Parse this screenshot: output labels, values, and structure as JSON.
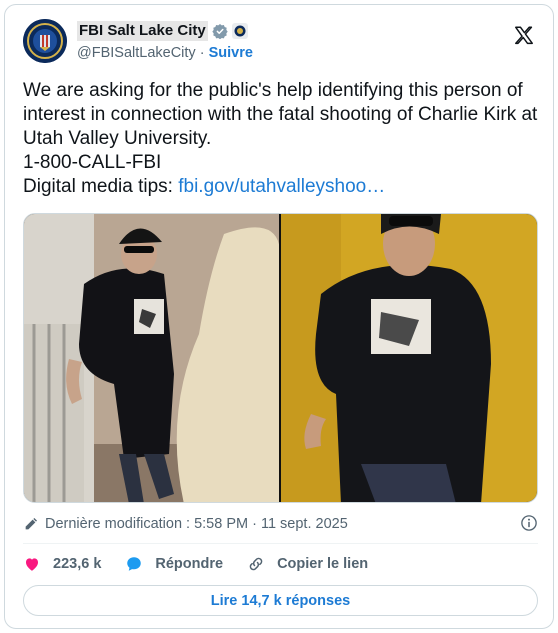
{
  "post": {
    "display_name": "FBI Salt Lake City",
    "handle": "@FBISaltLakeCity",
    "separator": "·",
    "follow_label": "Suivre",
    "text_line1": "We are asking for the public's help identifying this person of interest in connection with the fatal shooting of Charlie Kirk at Utah Valley University.",
    "text_line2": "1-800-CALL-FBI",
    "text_line3_prefix": "Digital media tips: ",
    "text_link": "fbi.gov/utahvalleyshoo…",
    "modified_label": "Dernière modification : 5:58 PM · 11 sept. 2025"
  },
  "actions": {
    "likes": "223,6 k",
    "reply_label": "Répondre",
    "copy_link_label": "Copier le lien",
    "read_replies_label": "Lire 14,7 k réponses"
  },
  "colors": {
    "link": "#1d7bd4",
    "heart": "#f91880",
    "reply_bubble": "#1d9bf0",
    "verified_badge": "#829aab"
  },
  "icons": [
    "fbi-seal-icon",
    "verified-icon",
    "affiliate-badge-icon",
    "x-logo-icon",
    "pencil-icon",
    "info-icon",
    "heart-icon",
    "reply-icon",
    "link-icon"
  ]
}
